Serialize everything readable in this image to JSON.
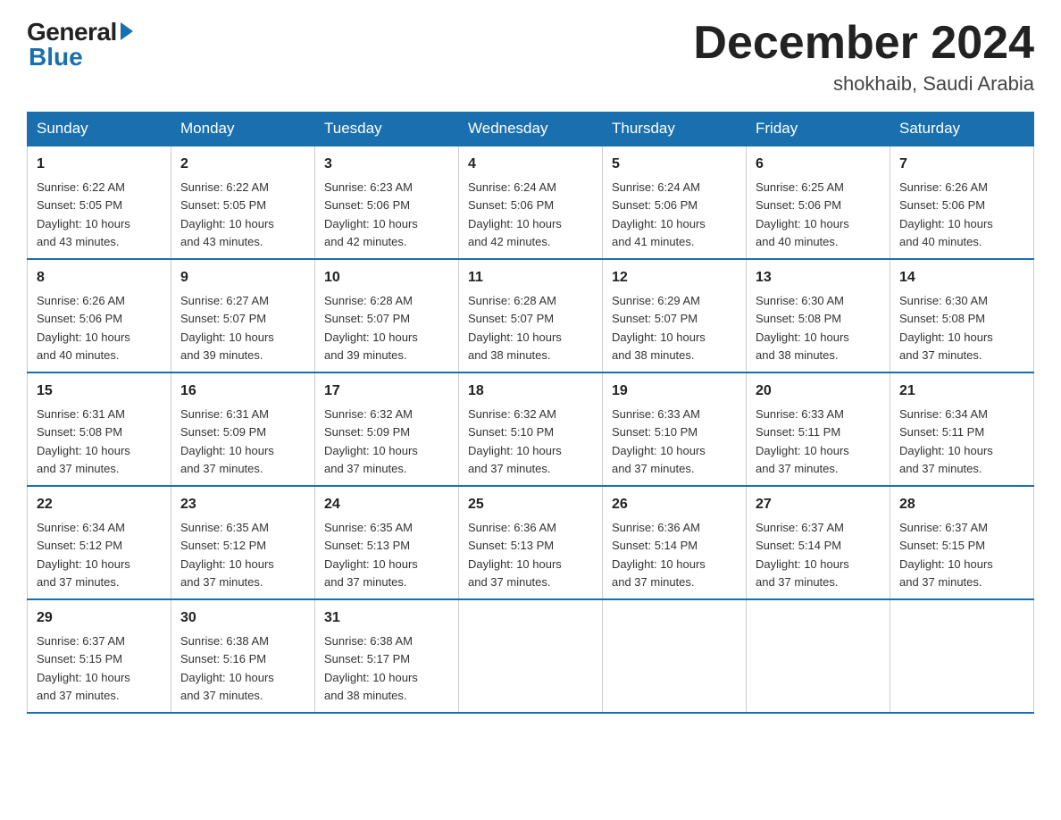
{
  "logo": {
    "text_general": "General",
    "text_blue": "Blue"
  },
  "header": {
    "month_title": "December 2024",
    "subtitle": "shokhaib, Saudi Arabia"
  },
  "weekdays": [
    "Sunday",
    "Monday",
    "Tuesday",
    "Wednesday",
    "Thursday",
    "Friday",
    "Saturday"
  ],
  "weeks": [
    [
      {
        "day": "1",
        "sunrise": "6:22 AM",
        "sunset": "5:05 PM",
        "daylight": "10 hours and 43 minutes."
      },
      {
        "day": "2",
        "sunrise": "6:22 AM",
        "sunset": "5:05 PM",
        "daylight": "10 hours and 43 minutes."
      },
      {
        "day": "3",
        "sunrise": "6:23 AM",
        "sunset": "5:06 PM",
        "daylight": "10 hours and 42 minutes."
      },
      {
        "day": "4",
        "sunrise": "6:24 AM",
        "sunset": "5:06 PM",
        "daylight": "10 hours and 42 minutes."
      },
      {
        "day": "5",
        "sunrise": "6:24 AM",
        "sunset": "5:06 PM",
        "daylight": "10 hours and 41 minutes."
      },
      {
        "day": "6",
        "sunrise": "6:25 AM",
        "sunset": "5:06 PM",
        "daylight": "10 hours and 40 minutes."
      },
      {
        "day": "7",
        "sunrise": "6:26 AM",
        "sunset": "5:06 PM",
        "daylight": "10 hours and 40 minutes."
      }
    ],
    [
      {
        "day": "8",
        "sunrise": "6:26 AM",
        "sunset": "5:06 PM",
        "daylight": "10 hours and 40 minutes."
      },
      {
        "day": "9",
        "sunrise": "6:27 AM",
        "sunset": "5:07 PM",
        "daylight": "10 hours and 39 minutes."
      },
      {
        "day": "10",
        "sunrise": "6:28 AM",
        "sunset": "5:07 PM",
        "daylight": "10 hours and 39 minutes."
      },
      {
        "day": "11",
        "sunrise": "6:28 AM",
        "sunset": "5:07 PM",
        "daylight": "10 hours and 38 minutes."
      },
      {
        "day": "12",
        "sunrise": "6:29 AM",
        "sunset": "5:07 PM",
        "daylight": "10 hours and 38 minutes."
      },
      {
        "day": "13",
        "sunrise": "6:30 AM",
        "sunset": "5:08 PM",
        "daylight": "10 hours and 38 minutes."
      },
      {
        "day": "14",
        "sunrise": "6:30 AM",
        "sunset": "5:08 PM",
        "daylight": "10 hours and 37 minutes."
      }
    ],
    [
      {
        "day": "15",
        "sunrise": "6:31 AM",
        "sunset": "5:08 PM",
        "daylight": "10 hours and 37 minutes."
      },
      {
        "day": "16",
        "sunrise": "6:31 AM",
        "sunset": "5:09 PM",
        "daylight": "10 hours and 37 minutes."
      },
      {
        "day": "17",
        "sunrise": "6:32 AM",
        "sunset": "5:09 PM",
        "daylight": "10 hours and 37 minutes."
      },
      {
        "day": "18",
        "sunrise": "6:32 AM",
        "sunset": "5:10 PM",
        "daylight": "10 hours and 37 minutes."
      },
      {
        "day": "19",
        "sunrise": "6:33 AM",
        "sunset": "5:10 PM",
        "daylight": "10 hours and 37 minutes."
      },
      {
        "day": "20",
        "sunrise": "6:33 AM",
        "sunset": "5:11 PM",
        "daylight": "10 hours and 37 minutes."
      },
      {
        "day": "21",
        "sunrise": "6:34 AM",
        "sunset": "5:11 PM",
        "daylight": "10 hours and 37 minutes."
      }
    ],
    [
      {
        "day": "22",
        "sunrise": "6:34 AM",
        "sunset": "5:12 PM",
        "daylight": "10 hours and 37 minutes."
      },
      {
        "day": "23",
        "sunrise": "6:35 AM",
        "sunset": "5:12 PM",
        "daylight": "10 hours and 37 minutes."
      },
      {
        "day": "24",
        "sunrise": "6:35 AM",
        "sunset": "5:13 PM",
        "daylight": "10 hours and 37 minutes."
      },
      {
        "day": "25",
        "sunrise": "6:36 AM",
        "sunset": "5:13 PM",
        "daylight": "10 hours and 37 minutes."
      },
      {
        "day": "26",
        "sunrise": "6:36 AM",
        "sunset": "5:14 PM",
        "daylight": "10 hours and 37 minutes."
      },
      {
        "day": "27",
        "sunrise": "6:37 AM",
        "sunset": "5:14 PM",
        "daylight": "10 hours and 37 minutes."
      },
      {
        "day": "28",
        "sunrise": "6:37 AM",
        "sunset": "5:15 PM",
        "daylight": "10 hours and 37 minutes."
      }
    ],
    [
      {
        "day": "29",
        "sunrise": "6:37 AM",
        "sunset": "5:15 PM",
        "daylight": "10 hours and 37 minutes."
      },
      {
        "day": "30",
        "sunrise": "6:38 AM",
        "sunset": "5:16 PM",
        "daylight": "10 hours and 37 minutes."
      },
      {
        "day": "31",
        "sunrise": "6:38 AM",
        "sunset": "5:17 PM",
        "daylight": "10 hours and 38 minutes."
      },
      null,
      null,
      null,
      null
    ]
  ],
  "labels": {
    "sunrise": "Sunrise:",
    "sunset": "Sunset:",
    "daylight": "Daylight:"
  }
}
